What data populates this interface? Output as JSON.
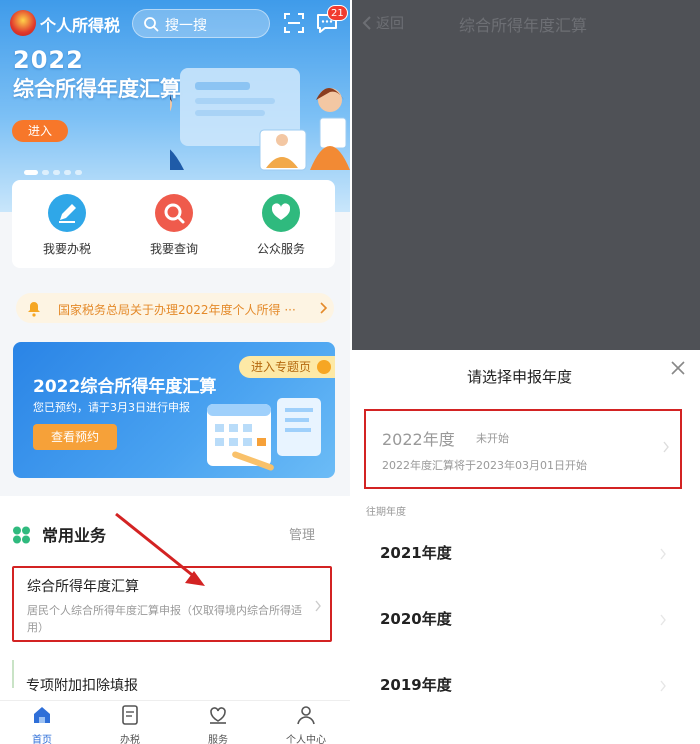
{
  "left": {
    "app_title": "个人所得税",
    "search_placeholder": "搜一搜",
    "message_badge": "21",
    "banner": {
      "year": "2022",
      "title": "综合所得年度汇算",
      "enter_label": "进入"
    },
    "quick_actions": [
      {
        "label": "我要办税",
        "icon": "pen-icon",
        "color": "#2fa7e8"
      },
      {
        "label": "我要查询",
        "icon": "search-icon",
        "color": "#ef5b4c"
      },
      {
        "label": "公众服务",
        "icon": "heart-hand-icon",
        "color": "#2fba7e"
      }
    ],
    "notice_text": "国家税务总局关于办理2022年度个人所得 ···",
    "promo": {
      "tag": "进入专题页",
      "title": "2022综合所得年度汇算",
      "subtitle": "您已预约，请于3月3日进行申报",
      "button": "查看预约"
    },
    "common": {
      "title": "常用业务",
      "manage": "管理",
      "items": [
        {
          "title": "综合所得年度汇算",
          "desc": "居民个人综合所得年度汇算申报（仅取得境内综合所得适用）"
        },
        {
          "title": "专项附加扣除填报"
        }
      ]
    },
    "tabs": [
      {
        "label": "首页",
        "icon": "home-icon",
        "active": true
      },
      {
        "label": "办税",
        "icon": "document-icon",
        "active": false
      },
      {
        "label": "服务",
        "icon": "heart-hand-icon",
        "active": false
      },
      {
        "label": "个人中心",
        "icon": "person-icon",
        "active": false
      }
    ]
  },
  "right": {
    "back_label": "返回",
    "page_title": "综合所得年度汇算",
    "sheet_title": "请选择申报年度",
    "current": {
      "year": "2022年度",
      "status": "未开始",
      "note": "2022年度汇算将于2023年03月01日开始"
    },
    "past_label": "往期年度",
    "past_years": [
      "2021年度",
      "2020年度",
      "2019年度"
    ]
  },
  "colors": {
    "accent_blue": "#2f6fd8",
    "highlight_red": "#d32323",
    "notice_orange": "#e48a2a"
  }
}
